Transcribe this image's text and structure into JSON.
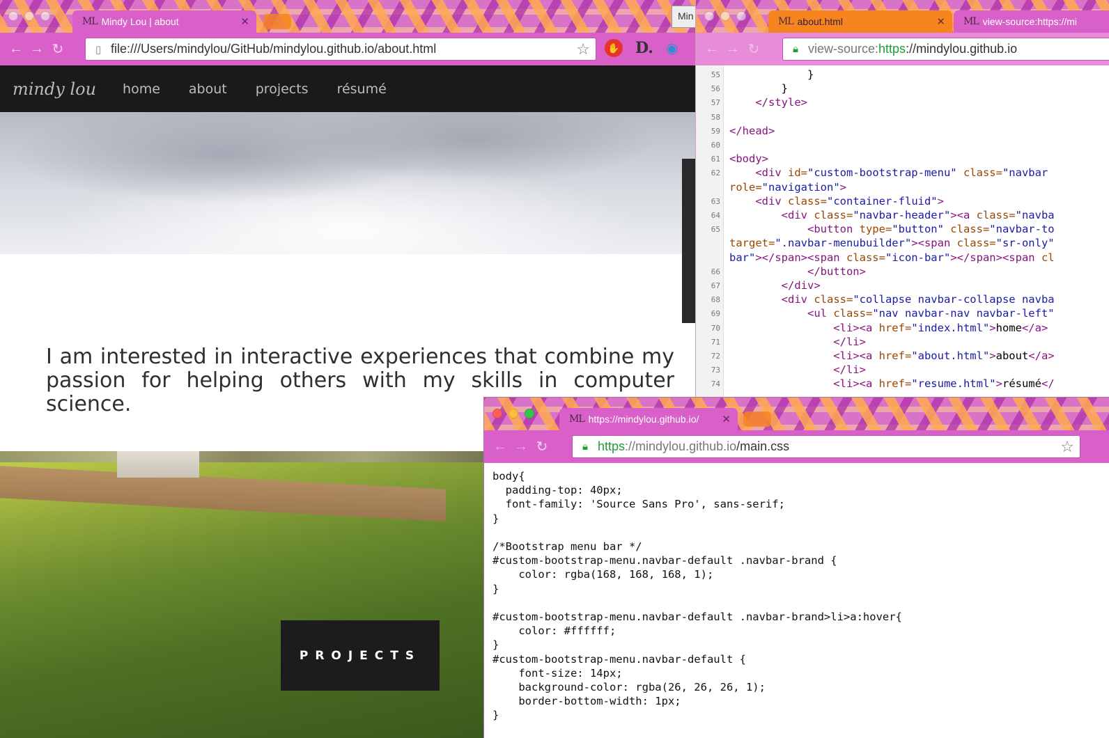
{
  "windowA": {
    "tab_active": {
      "favicon": "ML",
      "title": "Mindy Lou | about"
    },
    "tab_partial": "Min",
    "url": "file:///Users/mindylou/GitHub/mindylou.github.io/about.html",
    "extensions": [
      "ublock-icon",
      "d-icon",
      "eye-icon"
    ],
    "site": {
      "brand": "mindy lou",
      "nav": [
        "home",
        "about",
        "projects",
        "résumé"
      ],
      "intro": "I am interested in interactive experiences that combine my passion for helping others with my skills in computer science.",
      "projects_button": "PROJECTS"
    }
  },
  "windowB": {
    "tab_active": {
      "favicon": "ML",
      "title": "about.html"
    },
    "tab_second": {
      "favicon": "ML",
      "title": "view-source:https://mi"
    },
    "url": {
      "prefix": "view-source:",
      "scheme": "https",
      "rest": "://mindylou.github.io"
    },
    "lines": [
      {
        "n": "55",
        "parts": [
          [
            "tx",
            "            }"
          ]
        ]
      },
      {
        "n": "56",
        "parts": [
          [
            "tx",
            "        }"
          ]
        ]
      },
      {
        "n": "57",
        "parts": [
          [
            "tg",
            "    </style>"
          ]
        ]
      },
      {
        "n": "58",
        "parts": []
      },
      {
        "n": "59",
        "parts": [
          [
            "tg",
            "</head>"
          ]
        ]
      },
      {
        "n": "60",
        "parts": []
      },
      {
        "n": "61",
        "parts": [
          [
            "tg",
            "<body>"
          ]
        ]
      },
      {
        "n": "62",
        "parts": [
          [
            "tg",
            "    <div "
          ],
          [
            "an",
            "id="
          ],
          [
            "av",
            "\"custom-bootstrap-menu\""
          ],
          [
            "an",
            " class="
          ],
          [
            "av",
            "\"navbar"
          ]
        ]
      },
      {
        "n": "",
        "parts": [
          [
            "an",
            "role="
          ],
          [
            "av",
            "\"navigation\""
          ],
          [
            "tg",
            ">"
          ]
        ]
      },
      {
        "n": "63",
        "parts": [
          [
            "tg",
            "    <div "
          ],
          [
            "an",
            "class="
          ],
          [
            "av",
            "\"container-fluid\""
          ],
          [
            "tg",
            ">"
          ]
        ]
      },
      {
        "n": "64",
        "parts": [
          [
            "tg",
            "        <div "
          ],
          [
            "an",
            "class="
          ],
          [
            "av",
            "\"navbar-header\""
          ],
          [
            "tg",
            "><a "
          ],
          [
            "an",
            "class="
          ],
          [
            "av",
            "\"navba"
          ]
        ]
      },
      {
        "n": "65",
        "parts": [
          [
            "tg",
            "            <button "
          ],
          [
            "an",
            "type="
          ],
          [
            "av",
            "\"button\""
          ],
          [
            "an",
            " class="
          ],
          [
            "av",
            "\"navbar-to"
          ]
        ]
      },
      {
        "n": "",
        "parts": [
          [
            "an",
            "target="
          ],
          [
            "av",
            "\".navbar-menubuilder\""
          ],
          [
            "tg",
            "><span "
          ],
          [
            "an",
            "class="
          ],
          [
            "av",
            "\"sr-only\""
          ]
        ]
      },
      {
        "n": "",
        "parts": [
          [
            "av",
            "bar\""
          ],
          [
            "tg",
            "></span><span "
          ],
          [
            "an",
            "class="
          ],
          [
            "av",
            "\"icon-bar\""
          ],
          [
            "tg",
            "></span><span "
          ],
          [
            "an",
            "cl"
          ]
        ]
      },
      {
        "n": "66",
        "parts": [
          [
            "tg",
            "            </button>"
          ]
        ]
      },
      {
        "n": "67",
        "parts": [
          [
            "tg",
            "        </div>"
          ]
        ]
      },
      {
        "n": "68",
        "parts": [
          [
            "tg",
            "        <div "
          ],
          [
            "an",
            "class="
          ],
          [
            "av",
            "\"collapse navbar-collapse navba"
          ]
        ]
      },
      {
        "n": "69",
        "parts": [
          [
            "tg",
            "            <ul "
          ],
          [
            "an",
            "class="
          ],
          [
            "av",
            "\"nav navbar-nav navbar-left\""
          ]
        ]
      },
      {
        "n": "70",
        "parts": [
          [
            "tg",
            "                <li><a "
          ],
          [
            "an",
            "href="
          ],
          [
            "av",
            "\"index.html\""
          ],
          [
            "tg",
            ">"
          ],
          [
            "tx",
            "home"
          ],
          [
            "tg",
            "</a>"
          ]
        ]
      },
      {
        "n": "71",
        "parts": [
          [
            "tg",
            "                </li>"
          ]
        ]
      },
      {
        "n": "72",
        "parts": [
          [
            "tg",
            "                <li><a "
          ],
          [
            "an",
            "href="
          ],
          [
            "av",
            "\"about.html\""
          ],
          [
            "tg",
            ">"
          ],
          [
            "tx",
            "about"
          ],
          [
            "tg",
            "</a>"
          ]
        ]
      },
      {
        "n": "73",
        "parts": [
          [
            "tg",
            "                </li>"
          ]
        ]
      },
      {
        "n": "74",
        "parts": [
          [
            "tg",
            "                <li><a "
          ],
          [
            "an",
            "href="
          ],
          [
            "av",
            "\"resume.html\""
          ],
          [
            "tg",
            ">"
          ],
          [
            "tx",
            "résumé"
          ],
          [
            "tg",
            "</"
          ]
        ]
      }
    ]
  },
  "windowC": {
    "tab_active": {
      "favicon": "ML",
      "title": "https://mindylou.github.io/"
    },
    "url": {
      "scheme": "https",
      "host": "://mindylou.github.io",
      "path": "/main.css"
    },
    "lines": [
      "body{",
      "  padding-top: 40px;",
      "  font-family: 'Source Sans Pro', sans-serif;",
      "}",
      "",
      "/*Bootstrap menu bar */",
      "#custom-bootstrap-menu.navbar-default .navbar-brand {",
      "    color: rgba(168, 168, 168, 1);",
      "}",
      "",
      "#custom-bootstrap-menu.navbar-default .navbar-brand>li>a:hover{",
      "    color: #ffffff;",
      "}",
      "#custom-bootstrap-menu.navbar-default {",
      "    font-size: 14px;",
      "    background-color: rgba(26, 26, 26, 1);",
      "    border-bottom-width: 1px;",
      "}"
    ]
  },
  "colors": {
    "toolbar": "#d860c8",
    "nav_dark": "#1a1a1a",
    "active_tab_orange": "#f6851f"
  }
}
